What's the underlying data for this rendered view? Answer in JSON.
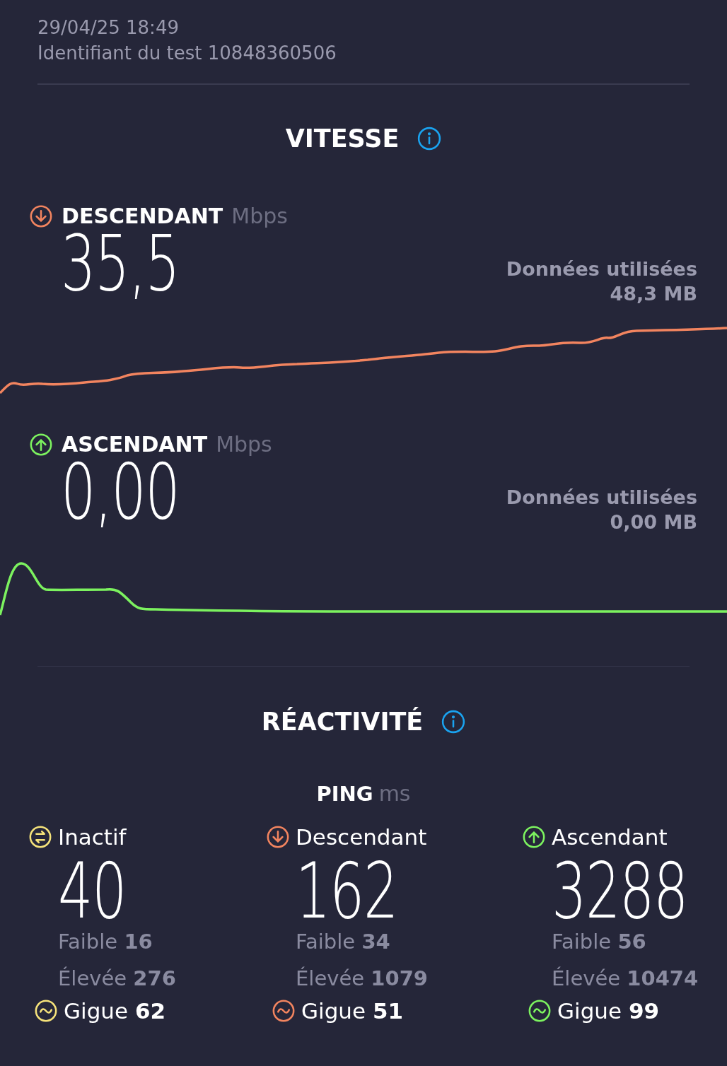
{
  "header": {
    "date": "29/04/25 18:49",
    "test_id": "Identifiant du test 10848360506"
  },
  "speed": {
    "title": "VITESSE",
    "sections": [
      {
        "kind": "download",
        "color": "#f2845f",
        "label": "DESCENDANT",
        "unit": "Mbps",
        "value": "35,5",
        "data_label": "Données utilisées",
        "data_value": "48,3 MB"
      },
      {
        "kind": "upload",
        "color": "#7cf25f",
        "label": "ASCENDANT",
        "unit": "Mbps",
        "value": "0,00",
        "data_label": "Données utilisées",
        "data_value": "0,00 MB"
      }
    ]
  },
  "responsiveness": {
    "title": "RÉACTIVITÉ",
    "ping_label": "PING",
    "ping_unit": "ms",
    "columns": [
      {
        "kind": "idle",
        "color": "#f5e27a",
        "label": "Inactif",
        "value": "40",
        "low": "Faible **16**",
        "high": "Élevée **276**",
        "jitter": "Gigue **62**"
      },
      {
        "kind": "download",
        "color": "#f2845f",
        "label": "Descendant",
        "value": "162",
        "low": "Faible **34**",
        "high": "Élevée **1079**",
        "jitter": "Gigue **51**"
      },
      {
        "kind": "upload",
        "color": "#7cf25f",
        "label": "Ascendant",
        "value": "3288",
        "low": "Faible **56**",
        "high": "Élevée **10474**",
        "jitter": "Gigue **99**"
      }
    ]
  }
}
